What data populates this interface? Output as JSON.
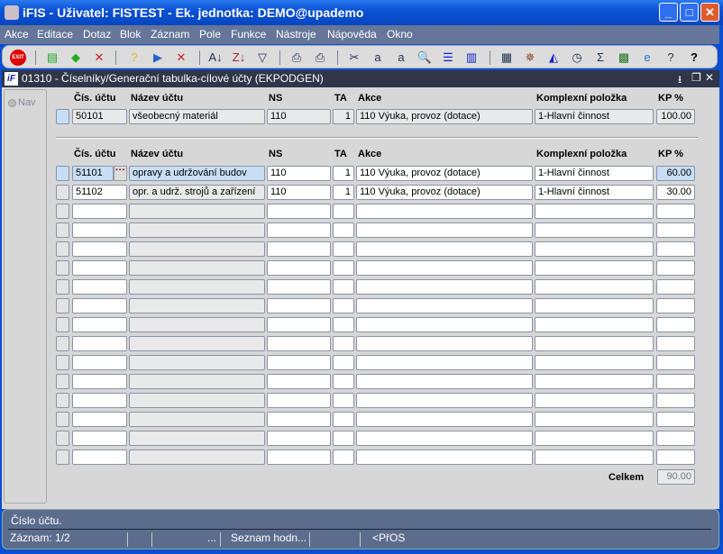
{
  "window": {
    "title": "iFIS - Uživatel: FISTEST - Ek. jednotka: DEMO@upademo",
    "minimize": "_",
    "maximize": "□",
    "close": "✕"
  },
  "menu": [
    "Akce",
    "Editace",
    "Dotaz",
    "Blok",
    "Záznam",
    "Pole",
    "Funkce",
    "Nástroje",
    "Nápověda",
    "Okno"
  ],
  "toolbar": {
    "exit": "EXIT",
    "icons": [
      "insert-record-icon",
      "save-record-icon",
      "delete-record-icon",
      "query-help-icon",
      "execute-query-icon",
      "cancel-query-icon",
      "sort-asc-icon",
      "sort-desc-icon",
      "filter-icon",
      "print-icon",
      "print-preview-icon",
      "cut-icon",
      "copy-icon",
      "paste-icon",
      "find-icon",
      "list-icon",
      "columns-icon",
      "import-icon",
      "settings-icon",
      "view-icon",
      "calendar-icon",
      "sum-icon",
      "excel-icon",
      "browser-icon",
      "help-context-icon",
      "help-icon"
    ]
  },
  "form": {
    "title": "01310 - Číselníky/Generační tabulka-cílové účty (EKPODGEN)",
    "logo": "iF",
    "nav_label": "Nav"
  },
  "columns": {
    "cis": "Čís. účtu",
    "nazev": "Název účtu",
    "ns": "NS",
    "ta": "TA",
    "akce": "Akce",
    "kp_item": "Komplexní položka",
    "kp": "KP %"
  },
  "master": {
    "cis": "50101",
    "nazev": "všeobecný materiál",
    "ns": "110",
    "ta": "1",
    "akce": "110 Výuka, provoz (dotace)",
    "kp_item": "1-Hlavní činnost",
    "kp": "100.00"
  },
  "detail": {
    "rows": [
      {
        "cis": "51101",
        "nazev": "opravy a udržování budov",
        "ns": "110",
        "ta": "1",
        "akce": "110 Výuka, provoz (dotace)",
        "kp_item": "1-Hlavní činnost",
        "kp": "60.00"
      },
      {
        "cis": "51102",
        "nazev": "opr. a udrž. strojů a zařízení",
        "ns": "110",
        "ta": "1",
        "akce": "110 Výuka, provoz (dotace)",
        "kp_item": "1-Hlavní činnost",
        "kp": "30.00"
      },
      {},
      {},
      {},
      {},
      {},
      {},
      {},
      {},
      {},
      {},
      {},
      {},
      {},
      {}
    ],
    "lov_button": "···"
  },
  "total": {
    "label": "Celkem",
    "value": "90.00"
  },
  "status": {
    "hint": "Číslo účtu.",
    "record": "Záznam: 1/2",
    "ellipsis": "...",
    "lov": "Seznam hodn...",
    "mode": "<PřOS"
  }
}
